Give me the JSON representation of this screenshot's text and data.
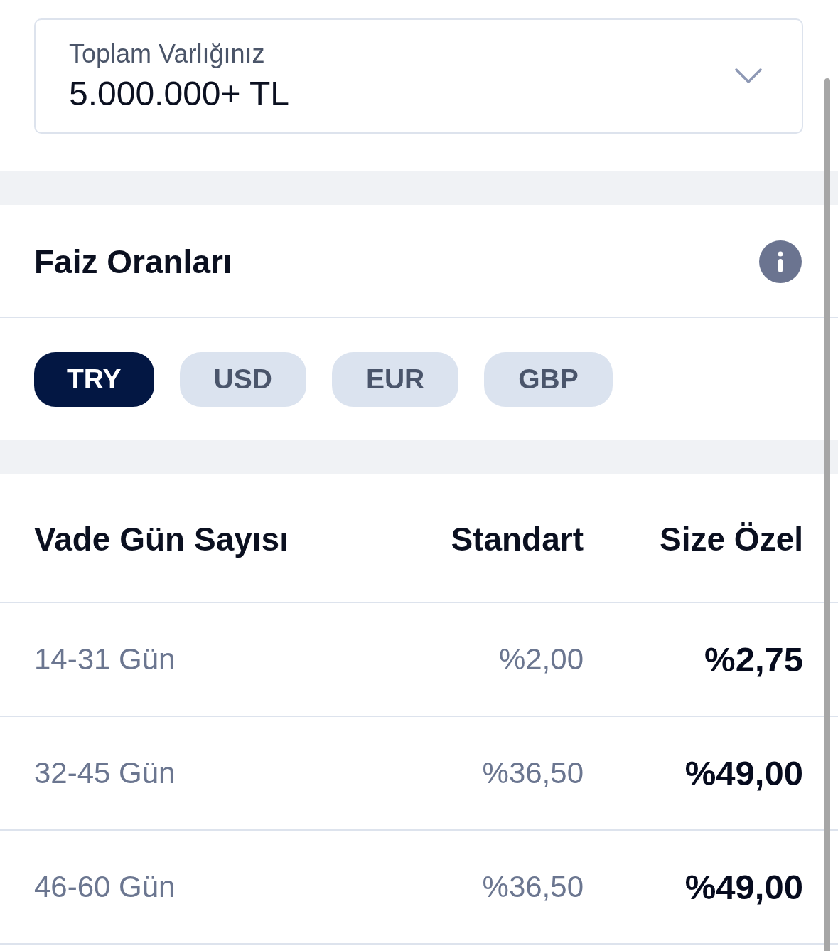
{
  "asset_select": {
    "label": "Toplam Varlığınız",
    "value": "5.000.000+ TL"
  },
  "rates": {
    "title": "Faiz Oranları",
    "currencies": [
      {
        "label": "TRY",
        "selected": true
      },
      {
        "label": "USD",
        "selected": false
      },
      {
        "label": "EUR",
        "selected": false
      },
      {
        "label": "GBP",
        "selected": false
      }
    ]
  },
  "table": {
    "columns": [
      "Vade Gün Sayısı",
      "Standart",
      "Size Özel"
    ],
    "rows": [
      {
        "term": "14-31 Gün",
        "standard": "%2,00",
        "special": "%2,75"
      },
      {
        "term": "32-45 Gün",
        "standard": "%36,50",
        "special": "%49,00"
      },
      {
        "term": "46-60 Gün",
        "standard": "%36,50",
        "special": "%49,00"
      }
    ]
  }
}
